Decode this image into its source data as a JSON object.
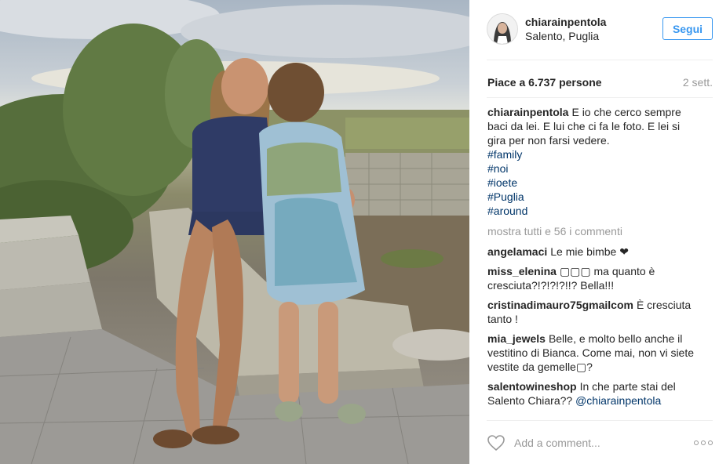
{
  "photo": {
    "alt": ""
  },
  "post": {
    "username": "chiarainpentola",
    "location": "Salento, Puglia",
    "follow_label": "Segui",
    "likes": "Piace a 6.737 persone",
    "time": "2 sett."
  },
  "caption": {
    "user": "chiarainpentola",
    "text": "E io che cerco sempre baci da lei. E lui che ci fa le foto. E lei si gira per non farsi vedere.",
    "tags": [
      "#family",
      "#noi",
      "#ioete",
      "#Puglia",
      "#around"
    ]
  },
  "show_all": "mostra tutti e 56 i commenti",
  "comments": [
    {
      "user": "angelamaci",
      "text": "Le mie bimbe ❤"
    },
    {
      "user": "miss_elenina",
      "text": "▢▢▢ ma quanto è cresciuta?!?!?!?!!? Bella!!!"
    },
    {
      "user": "cristinadimauro75gmailcom",
      "text": "È cresciuta tanto !"
    },
    {
      "user": "mia_jewels",
      "text": "Belle, e molto bello anche il vestitino di Bianca. Come mai, non vi siete vestite da gemelle▢?"
    },
    {
      "user": "salentowineshop",
      "text": "In che parte stai del Salento Chiara??",
      "mention": "@chiarainpentola"
    }
  ],
  "add_comment_placeholder": "Add a comment...",
  "icons": {
    "like": "heart-icon",
    "options": "more-options-icon"
  },
  "colors": {
    "link": "#003569",
    "button": "#3897f0",
    "muted": "#999999"
  }
}
